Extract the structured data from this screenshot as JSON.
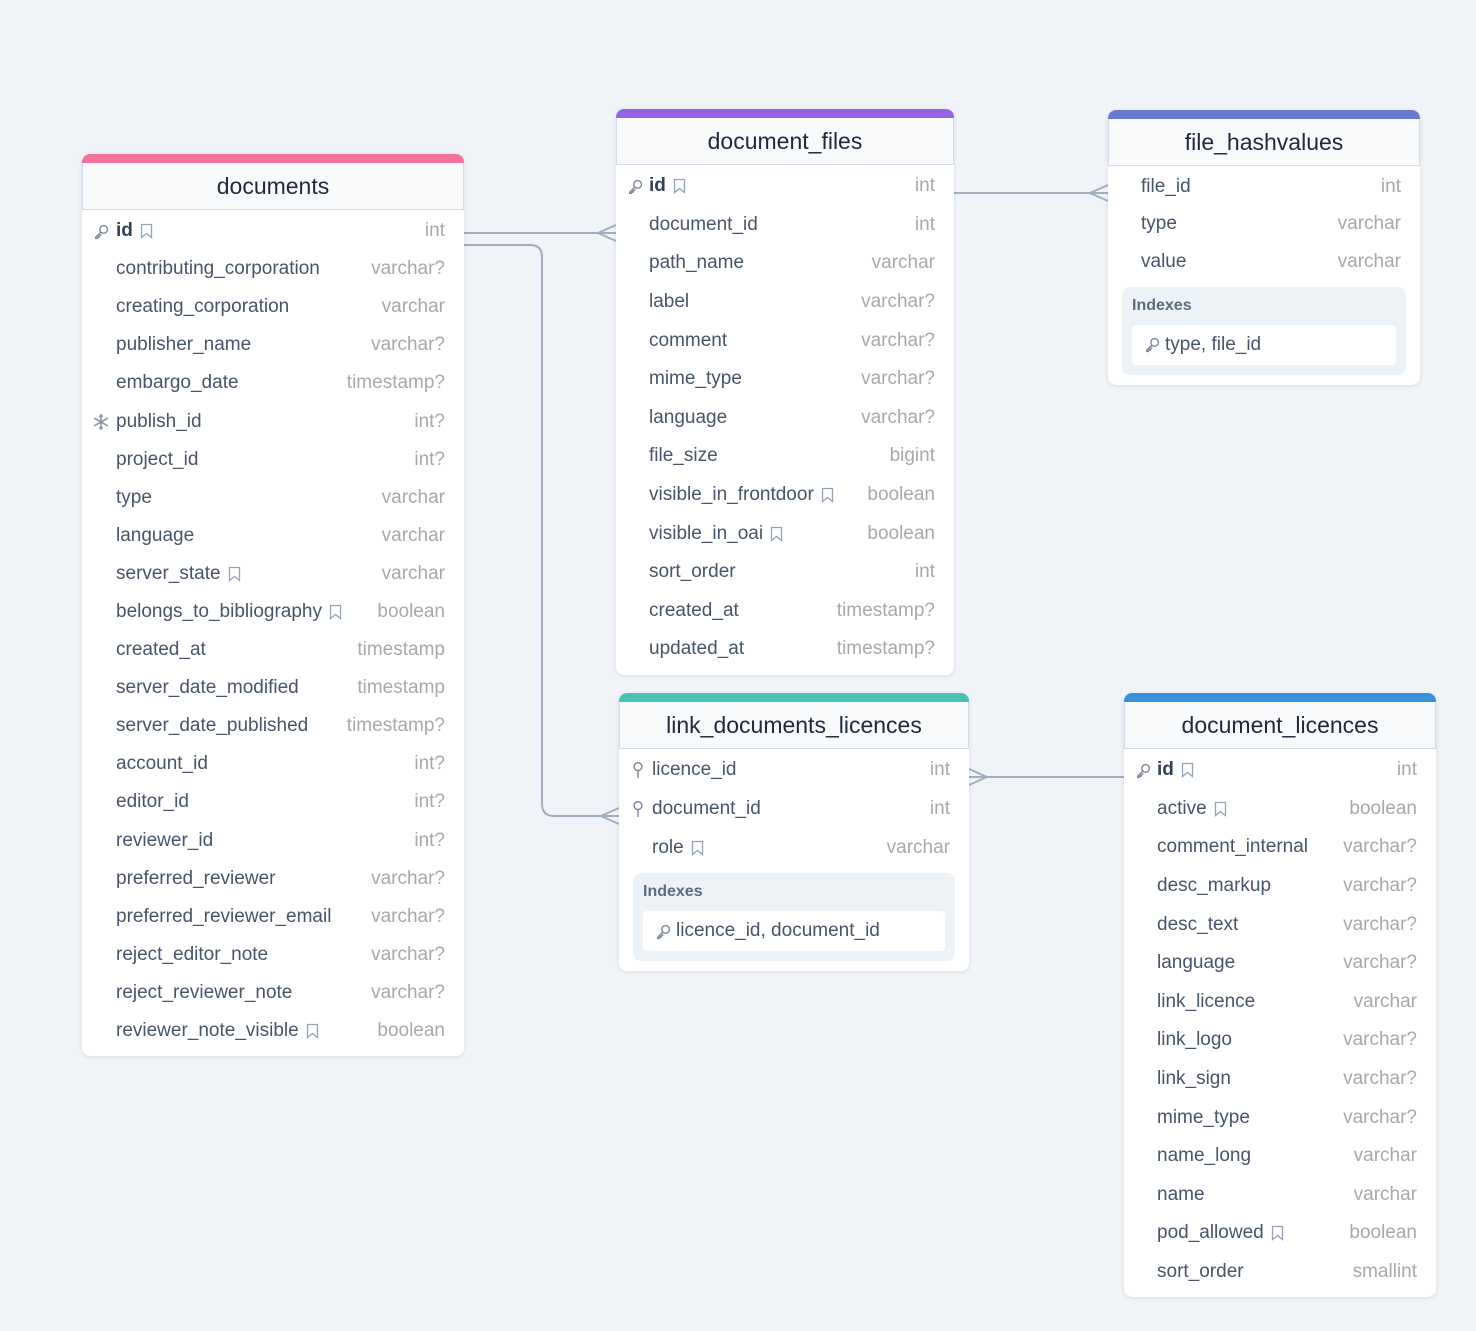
{
  "colors": {
    "background": "#f0f4f8",
    "documents": "#f4739b",
    "document_files": "#9863e0",
    "file_hashvalues": "#6a78cf",
    "link_documents_licences": "#4dbfb3",
    "document_licences": "#3a8fdc",
    "connector": "#a0aec0"
  },
  "tables": {
    "documents": {
      "name": "documents",
      "columns": [
        {
          "name": "id",
          "type": "int",
          "pk": true,
          "note": true,
          "icon": "key"
        },
        {
          "name": "contributing_corporation",
          "type": "varchar?"
        },
        {
          "name": "creating_corporation",
          "type": "varchar"
        },
        {
          "name": "publisher_name",
          "type": "varchar?"
        },
        {
          "name": "embargo_date",
          "type": "timestamp?"
        },
        {
          "name": "publish_id",
          "type": "int?",
          "icon": "snowflake"
        },
        {
          "name": "project_id",
          "type": "int?"
        },
        {
          "name": "type",
          "type": "varchar"
        },
        {
          "name": "language",
          "type": "varchar"
        },
        {
          "name": "server_state",
          "type": "varchar",
          "note": true
        },
        {
          "name": "belongs_to_bibliography",
          "type": "boolean",
          "note": true
        },
        {
          "name": "created_at",
          "type": "timestamp"
        },
        {
          "name": "server_date_modified",
          "type": "timestamp"
        },
        {
          "name": "server_date_published",
          "type": "timestamp?"
        },
        {
          "name": "account_id",
          "type": "int?"
        },
        {
          "name": "editor_id",
          "type": "int?"
        },
        {
          "name": "reviewer_id",
          "type": "int?"
        },
        {
          "name": "preferred_reviewer",
          "type": "varchar?"
        },
        {
          "name": "preferred_reviewer_email",
          "type": "varchar?"
        },
        {
          "name": "reject_editor_note",
          "type": "varchar?"
        },
        {
          "name": "reject_reviewer_note",
          "type": "varchar?"
        },
        {
          "name": "reviewer_note_visible",
          "type": "boolean",
          "note": true
        }
      ]
    },
    "document_files": {
      "name": "document_files",
      "columns": [
        {
          "name": "id",
          "type": "int",
          "pk": true,
          "note": true,
          "icon": "key"
        },
        {
          "name": "document_id",
          "type": "int"
        },
        {
          "name": "path_name",
          "type": "varchar"
        },
        {
          "name": "label",
          "type": "varchar?"
        },
        {
          "name": "comment",
          "type": "varchar?"
        },
        {
          "name": "mime_type",
          "type": "varchar?"
        },
        {
          "name": "language",
          "type": "varchar?"
        },
        {
          "name": "file_size",
          "type": "bigint"
        },
        {
          "name": "visible_in_frontdoor",
          "type": "boolean",
          "note": true
        },
        {
          "name": "visible_in_oai",
          "type": "boolean",
          "note": true
        },
        {
          "name": "sort_order",
          "type": "int"
        },
        {
          "name": "created_at",
          "type": "timestamp?"
        },
        {
          "name": "updated_at",
          "type": "timestamp?"
        }
      ]
    },
    "file_hashvalues": {
      "name": "file_hashvalues",
      "columns": [
        {
          "name": "file_id",
          "type": "int"
        },
        {
          "name": "type",
          "type": "varchar"
        },
        {
          "name": "value",
          "type": "varchar"
        }
      ],
      "indexes_label": "Indexes",
      "indexes": [
        "type, file_id"
      ]
    },
    "link_documents_licences": {
      "name": "link_documents_licences",
      "columns": [
        {
          "name": "licence_id",
          "type": "int",
          "icon": "pin"
        },
        {
          "name": "document_id",
          "type": "int",
          "icon": "pin"
        },
        {
          "name": "role",
          "type": "varchar",
          "note": true
        }
      ],
      "indexes_label": "Indexes",
      "indexes": [
        "licence_id, document_id"
      ]
    },
    "document_licences": {
      "name": "document_licences",
      "columns": [
        {
          "name": "id",
          "type": "int",
          "pk": true,
          "note": true,
          "icon": "key"
        },
        {
          "name": "active",
          "type": "boolean",
          "note": true
        },
        {
          "name": "comment_internal",
          "type": "varchar?"
        },
        {
          "name": "desc_markup",
          "type": "varchar?"
        },
        {
          "name": "desc_text",
          "type": "varchar?"
        },
        {
          "name": "language",
          "type": "varchar?"
        },
        {
          "name": "link_licence",
          "type": "varchar"
        },
        {
          "name": "link_logo",
          "type": "varchar?"
        },
        {
          "name": "link_sign",
          "type": "varchar?"
        },
        {
          "name": "mime_type",
          "type": "varchar?"
        },
        {
          "name": "name_long",
          "type": "varchar"
        },
        {
          "name": "name",
          "type": "varchar"
        },
        {
          "name": "pod_allowed",
          "type": "boolean",
          "note": true
        },
        {
          "name": "sort_order",
          "type": "smallint"
        }
      ]
    }
  },
  "relations": [
    {
      "from": "documents.id",
      "to": "document_files.document_id",
      "type": "one-to-many"
    },
    {
      "from": "document_files.id",
      "to": "file_hashvalues.file_id",
      "type": "one-to-many"
    },
    {
      "from": "documents.id",
      "to": "link_documents_licences.document_id",
      "type": "one-to-many"
    },
    {
      "from": "document_licences.id",
      "to": "link_documents_licences.licence_id",
      "type": "one-to-many"
    }
  ]
}
